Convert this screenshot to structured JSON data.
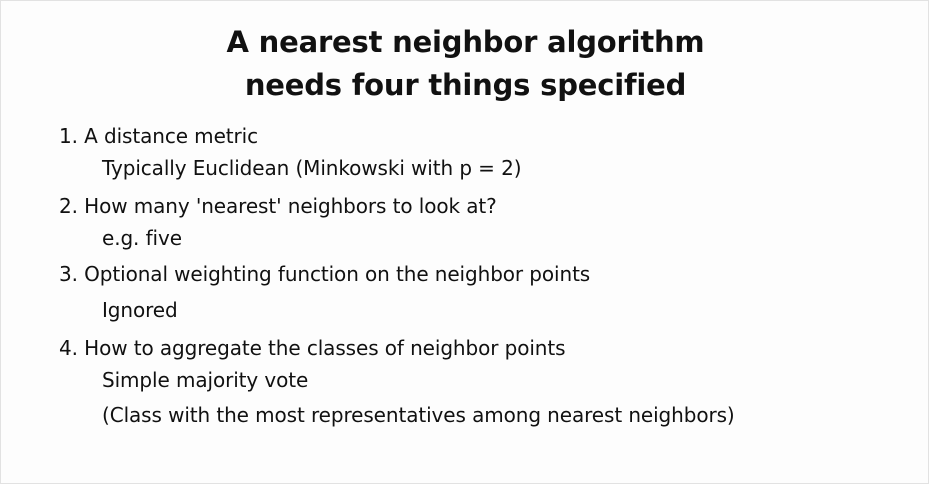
{
  "slide": {
    "title_lines": [
      "A nearest neighbor algorithm",
      "needs four things specified"
    ],
    "items": [
      {
        "heading": "1. A distance metric",
        "details": [
          "Typically Euclidean  (Minkowski with p = 2)"
        ]
      },
      {
        "heading": "2. How many 'nearest' neighbors to look at?",
        "details": [
          "e.g. five"
        ]
      },
      {
        "heading": "3. Optional weighting function on the neighbor points",
        "details": [
          "Ignored"
        ]
      },
      {
        "heading": "4. How to aggregate the classes of neighbor points",
        "details": [
          "Simple majority vote",
          "(Class with the most representatives among nearest neighbors)"
        ]
      }
    ]
  }
}
